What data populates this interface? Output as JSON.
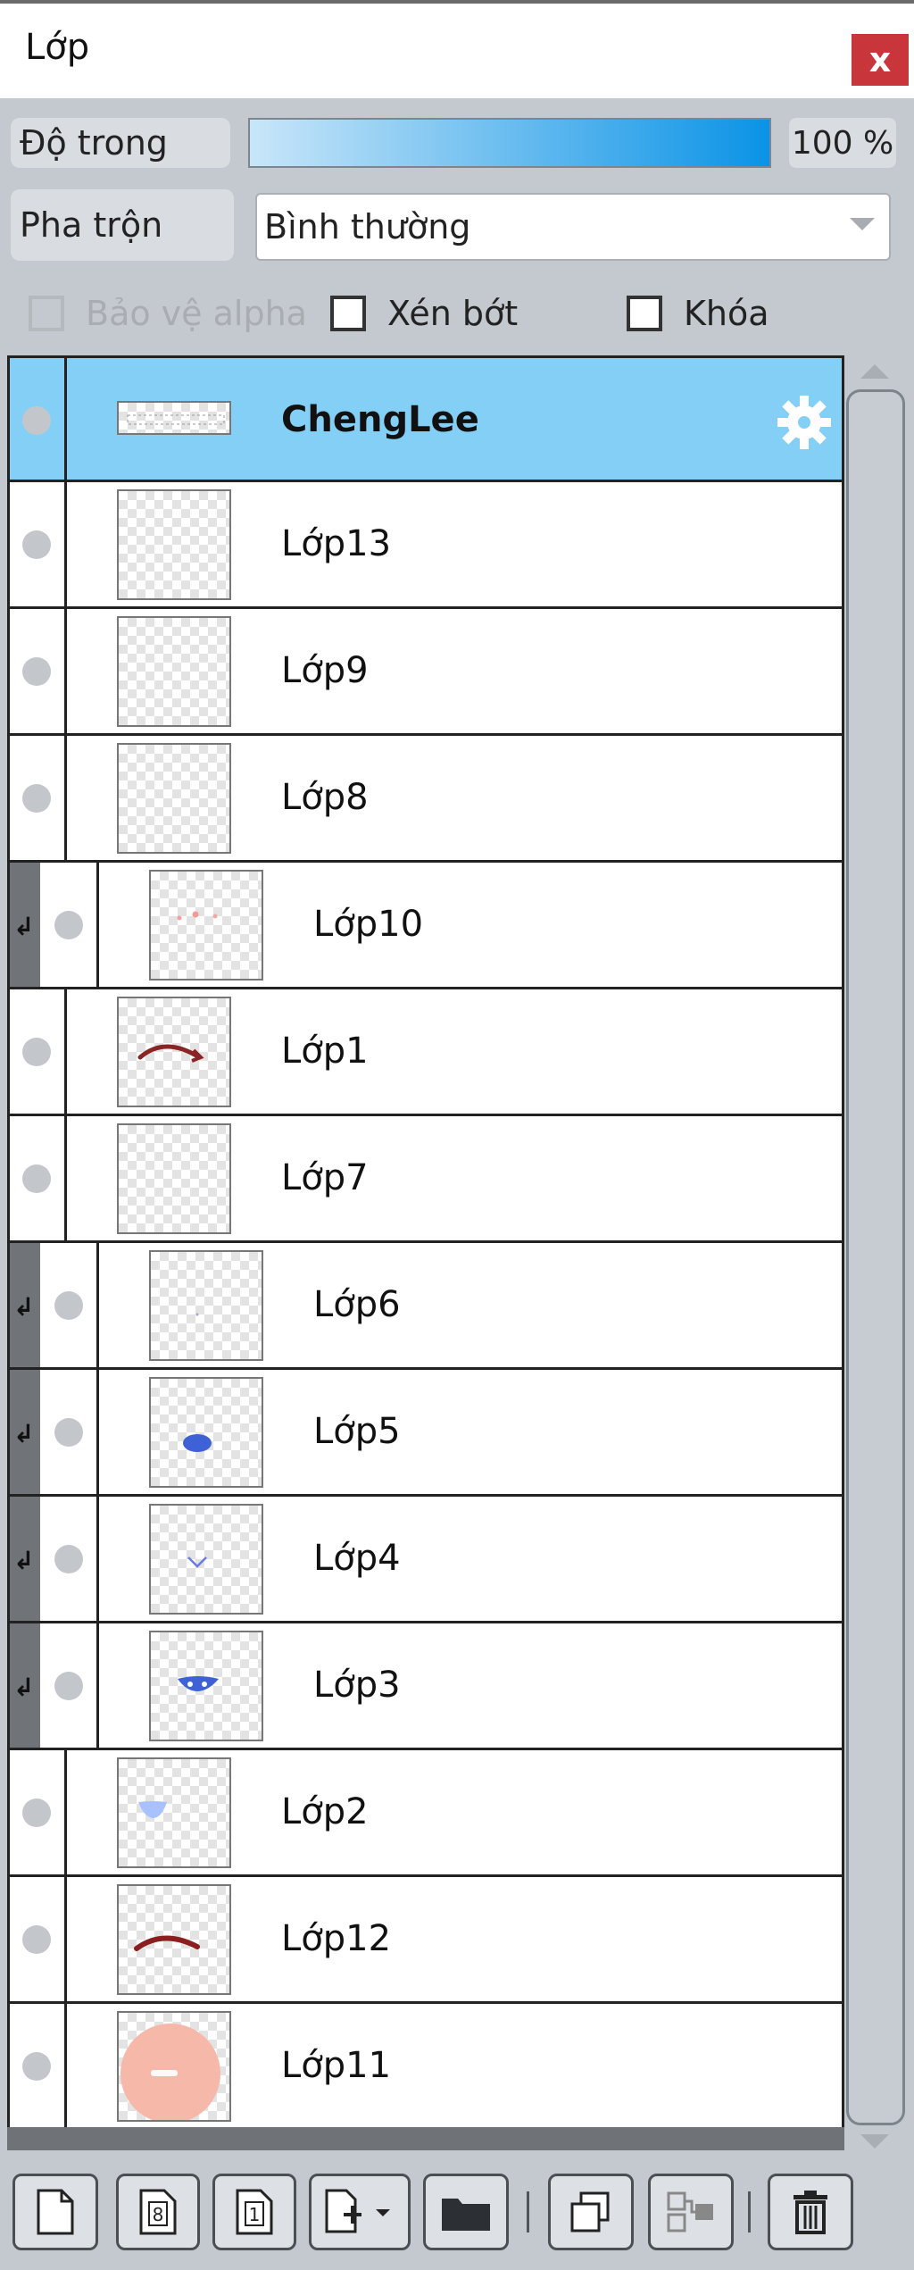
{
  "panel": {
    "title": "Lớp",
    "close_label": "x"
  },
  "properties": {
    "opacity_label": "Độ trong",
    "opacity_value": "100 %",
    "opacity_level": 1.0,
    "blend_label": "Pha trộn",
    "blend_value": "Bình thường"
  },
  "options": {
    "protect_alpha": "Bảo vệ alpha",
    "clipping": "Xén bớt",
    "lock": "Khóa"
  },
  "layers": [
    {
      "name": "ChengLee",
      "selected": true,
      "clipped": false,
      "thumb": "text"
    },
    {
      "name": "Lớp13",
      "selected": false,
      "clipped": false,
      "thumb": "empty"
    },
    {
      "name": "Lớp9",
      "selected": false,
      "clipped": false,
      "thumb": "empty"
    },
    {
      "name": "Lớp8",
      "selected": false,
      "clipped": false,
      "thumb": "empty"
    },
    {
      "name": "Lớp10",
      "selected": false,
      "clipped": true,
      "thumb": "pink-dots"
    },
    {
      "name": "Lớp1",
      "selected": false,
      "clipped": false,
      "thumb": "eyebrow-curve"
    },
    {
      "name": "Lớp7",
      "selected": false,
      "clipped": false,
      "thumb": "empty"
    },
    {
      "name": "Lớp6",
      "selected": false,
      "clipped": true,
      "thumb": "tiny-mark"
    },
    {
      "name": "Lớp5",
      "selected": false,
      "clipped": true,
      "thumb": "blue-blob"
    },
    {
      "name": "Lớp4",
      "selected": false,
      "clipped": true,
      "thumb": "blue-v"
    },
    {
      "name": "Lớp3",
      "selected": false,
      "clipped": true,
      "thumb": "blue-eye"
    },
    {
      "name": "Lớp2",
      "selected": false,
      "clipped": false,
      "thumb": "light-blue"
    },
    {
      "name": "Lớp12",
      "selected": false,
      "clipped": false,
      "thumb": "red-arc"
    },
    {
      "name": "Lớp11",
      "selected": false,
      "clipped": false,
      "thumb": "skin-face"
    }
  ],
  "toolbar": {
    "icons": [
      "new-layer-icon",
      "new-8bit-layer-icon",
      "new-1bit-layer-icon",
      "add-layer-dropdown-icon",
      "new-folder-icon",
      "duplicate-layer-icon",
      "merge-down-icon",
      "delete-layer-icon"
    ]
  },
  "colors": {
    "selected_row": "#83cff5",
    "close_button": "#c8363c",
    "opacity_fill_end": "#0a93e6",
    "clip_strip": "#707479"
  }
}
